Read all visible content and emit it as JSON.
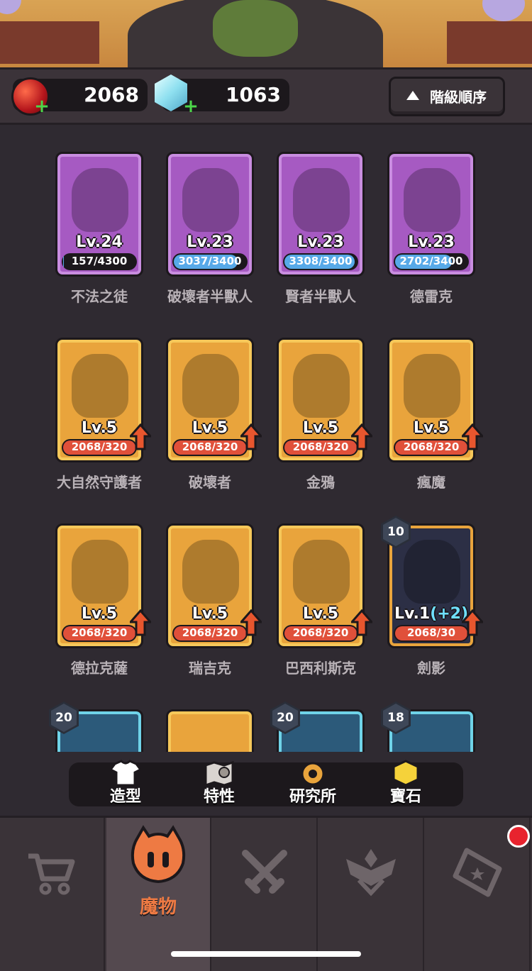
{
  "resources": {
    "red_orb_amount": "2068",
    "gem_amount": "1063"
  },
  "sort_button": {
    "label": "階級順序"
  },
  "monsters": [
    {
      "name": "不法之徒",
      "level": "Lv.24",
      "progress": "157/4300",
      "fill": 0.04,
      "rarity": "purple"
    },
    {
      "name": "破壞者半獸人",
      "level": "Lv.23",
      "progress": "3037/3400",
      "fill": 0.89,
      "rarity": "purple"
    },
    {
      "name": "賢者半獸人",
      "level": "Lv.23",
      "progress": "3308/3400",
      "fill": 0.97,
      "rarity": "purple"
    },
    {
      "name": "德雷克",
      "level": "Lv.23",
      "progress": "2702/3400",
      "fill": 0.79,
      "rarity": "purple"
    },
    {
      "name": "大自然守護者",
      "level": "Lv.5",
      "progress": "2068/320",
      "fill": 1.0,
      "rarity": "gold"
    },
    {
      "name": "破壞者",
      "level": "Lv.5",
      "progress": "2068/320",
      "fill": 1.0,
      "rarity": "gold"
    },
    {
      "name": "金鴉",
      "level": "Lv.5",
      "progress": "2068/320",
      "fill": 1.0,
      "rarity": "gold"
    },
    {
      "name": "瘋魔",
      "level": "Lv.5",
      "progress": "2068/320",
      "fill": 1.0,
      "rarity": "gold"
    },
    {
      "name": "德拉克薩",
      "level": "Lv.5",
      "progress": "2068/320",
      "fill": 1.0,
      "rarity": "gold"
    },
    {
      "name": "瑞吉克",
      "level": "Lv.5",
      "progress": "2068/320",
      "fill": 1.0,
      "rarity": "gold"
    },
    {
      "name": "巴西利斯克",
      "level": "Lv.5",
      "progress": "2068/320",
      "fill": 1.0,
      "rarity": "gold"
    },
    {
      "name": "劍影",
      "level": "Lv.1",
      "level_bonus": "(+2)",
      "progress": "2068/30",
      "fill": 1.0,
      "rarity": "dark",
      "badge": "10"
    }
  ],
  "partial_cards": [
    {
      "badge": "20",
      "rarity": "blue"
    },
    {
      "badge": "",
      "rarity": "gold"
    },
    {
      "badge": "20",
      "rarity": "blue"
    },
    {
      "badge": "18",
      "rarity": "blue"
    }
  ],
  "sub_tabs": [
    {
      "label": "造型",
      "icon": "shirt-icon"
    },
    {
      "label": "特性",
      "icon": "map-icon"
    },
    {
      "label": "研究所",
      "icon": "gear-icon"
    },
    {
      "label": "寶石",
      "icon": "gem-icon"
    }
  ],
  "bottom_nav": [
    {
      "label": "",
      "icon": "cart-icon"
    },
    {
      "label": "魔物",
      "icon": "monster-face-icon",
      "active": true
    },
    {
      "label": "",
      "icon": "crossed-swords-icon"
    },
    {
      "label": "",
      "icon": "rank-wings-icon"
    },
    {
      "label": "",
      "icon": "ticket-icon",
      "notification": true
    }
  ],
  "colors": {
    "accent_orange": "#ee7a43",
    "purple_card": "#a65ac2",
    "gold_card": "#e9a43c",
    "blue_card": "#6fd3e8",
    "notification_red": "#e8232e"
  }
}
